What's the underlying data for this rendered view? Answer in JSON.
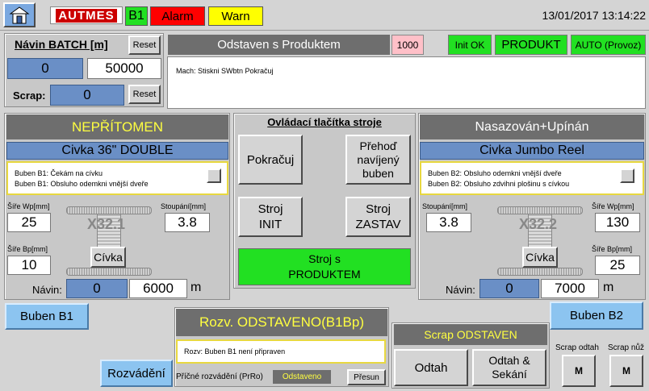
{
  "topbar": {
    "logo_text": "AUTMES",
    "b1_label": "B1",
    "alarm_label": "Alarm",
    "warn_label": "Warn",
    "datetime": "13/01/2017 13:14:22",
    "colors": {
      "alarm": "#ff0000",
      "warn": "#ffff00",
      "b1": "#22e022",
      "logo": "#cc0000"
    }
  },
  "batch": {
    "title": "Návin BATCH [m]",
    "reset_label": "Reset",
    "current_value": "0",
    "target_value": "50000",
    "scrap_label": "Scrap:",
    "scrap_value": "0",
    "scrap_reset_label": "Reset"
  },
  "status": {
    "title": "Odstaven s Produktem",
    "code": "1000",
    "init_ok": "Init OK",
    "produkt": "PRODUKT",
    "auto": "AUTO (Provoz)",
    "message": "Mach: Stiskni SWbtn Pokračuj"
  },
  "left_station": {
    "state": "NEPŘÍTOMEN",
    "reel_type": "Civka 36\" DOUBLE",
    "messages": [
      "Buben B1: Čekám na cívku",
      "Buben B1: Obsluho odemkni vnější dveře"
    ],
    "width_wp_label": "Šíře Wp[mm]",
    "width_wp": "25",
    "pitch_label": "Stoupání[mm]",
    "pitch": "3.8",
    "width_bp_label": "Šíře Bp[mm]",
    "width_bp": "10",
    "spool_id": "X32.1",
    "spool_button": "Cívka",
    "navin_label": "Návin:",
    "navin_current": "0",
    "navin_target": "6000",
    "unit": "m",
    "drum_button": "Buben B1"
  },
  "right_station": {
    "state": "Nasazován+Upínán",
    "reel_type": "Civka Jumbo Reel",
    "messages": [
      "Buben B2: Obsluho odemkni vnější dveře",
      "Buben B2: Obsluho zdvihni plošinu s cívkou"
    ],
    "pitch_label": "Stoupání[mm]",
    "pitch": "3.8",
    "width_wp_label": "Šíře Wp[mm]",
    "width_wp": "130",
    "width_bp_label": "Šíře Bp[mm]",
    "width_bp": "25",
    "spool_id": "X32.2",
    "spool_button": "Cívka",
    "navin_label": "Návin:",
    "navin_current": "0",
    "navin_target": "7000",
    "unit": "m",
    "drum_button": "Buben B2"
  },
  "controls": {
    "title": "Ovládací tlačítka stroje",
    "continue": "Pokračuj",
    "switch_drum": "Přehoď navíjený buben",
    "init": "Stroj INIT",
    "stop": "Stroj ZASTAV",
    "with_product": "Stroj s PRODUKTEM"
  },
  "distribution": {
    "button": "Rozvádění",
    "title": "Rozv. ODSTAVENO(B1Bp)",
    "message": "Rozv: Buben B1 není připraven",
    "cross_label": "Příčné rozvádění (PrRo)",
    "cross_state": "Odstaveno",
    "move_button": "Přesun"
  },
  "scrap": {
    "title": "Scrap ODSTAVEN",
    "remove": "Odtah",
    "remove_cut": "Odtah & Sekání",
    "remove_label": "Scrap odtah",
    "knife_label": "Scrap nůž",
    "m1": "M",
    "m2": "M"
  }
}
